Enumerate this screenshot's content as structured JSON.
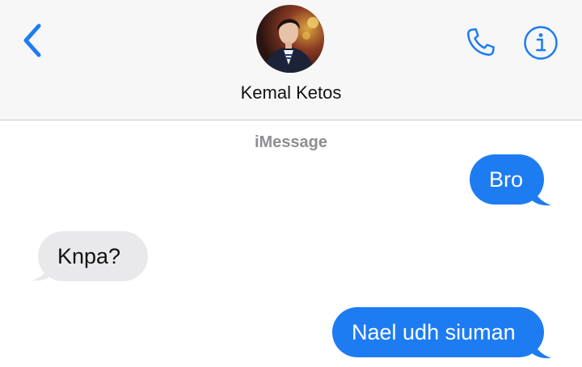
{
  "header": {
    "contact_name": "Kemal Ketos",
    "back_icon": "chevron-left-icon",
    "call_icon": "phone-icon",
    "info_icon": "info-icon",
    "accent_color": "#1e7cf2"
  },
  "conversation": {
    "service_label": "iMessage",
    "messages": [
      {
        "direction": "sent",
        "text": "Bro"
      },
      {
        "direction": "received",
        "text": "Knpa?"
      },
      {
        "direction": "sent",
        "text": "Nael udh siuman"
      }
    ]
  }
}
